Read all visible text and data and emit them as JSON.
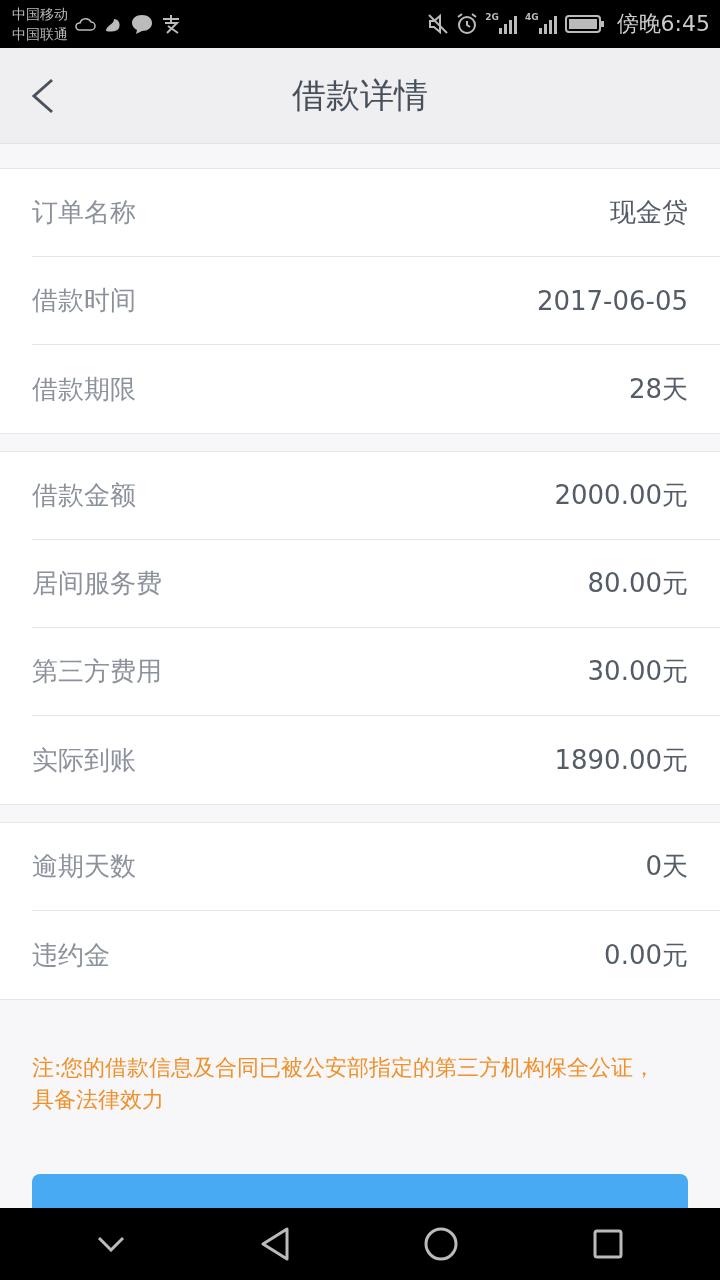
{
  "status_bar": {
    "carriers": [
      "中国移动",
      "中国联通"
    ],
    "network_2g": "2G",
    "network_4g": "4G",
    "time": "傍晚6:45"
  },
  "header": {
    "title": "借款详情"
  },
  "sections": [
    {
      "rows": [
        {
          "label": "订单名称",
          "value": "现金贷"
        },
        {
          "label": "借款时间",
          "value": "2017-06-05"
        },
        {
          "label": "借款期限",
          "value": "28天"
        }
      ]
    },
    {
      "rows": [
        {
          "label": "借款金额",
          "value": "2000.00元"
        },
        {
          "label": "居间服务费",
          "value": "80.00元"
        },
        {
          "label": "第三方费用",
          "value": "30.00元"
        },
        {
          "label": "实际到账",
          "value": "1890.00元"
        }
      ]
    },
    {
      "rows": [
        {
          "label": "逾期天数",
          "value": "0天"
        },
        {
          "label": "违约金",
          "value": "0.00元"
        }
      ]
    }
  ],
  "note": "注:您的借款信息及合同已被公安部指定的第三方机构保全公证，具备法律效力"
}
